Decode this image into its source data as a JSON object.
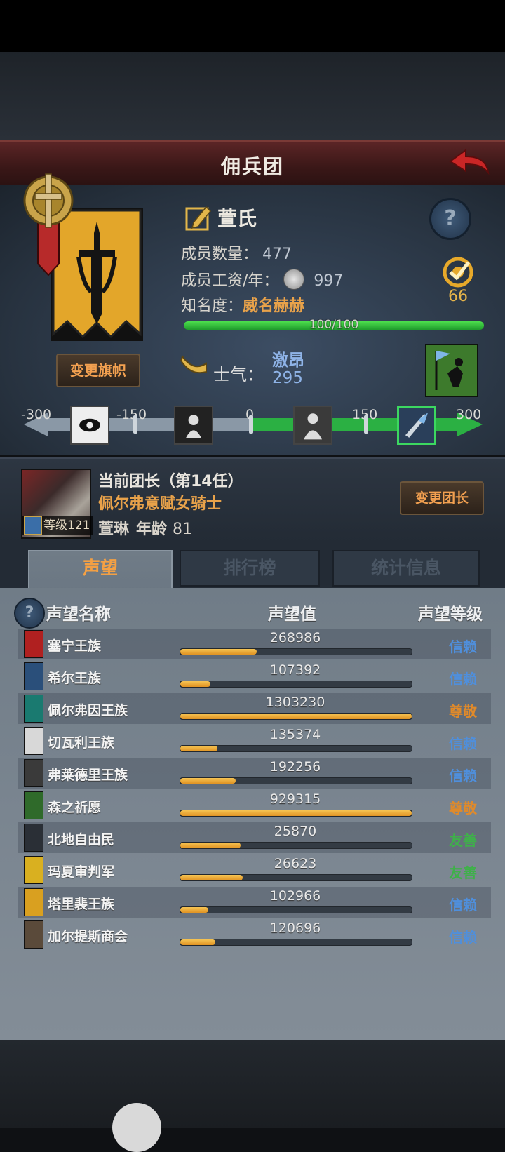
{
  "title": "佣兵团",
  "company": {
    "name": "萱氏",
    "change_flag": "变更旗帜",
    "members_label": "成员数量：",
    "members_value": "477",
    "wage_label": "成员工资/年：",
    "wage_value": "997",
    "fame_label": "知名度：",
    "fame_value": "威名赫赫",
    "fame_progress": "100/100",
    "fame_fraction": 1.0,
    "target_value": "66",
    "morale_label": "士气：",
    "morale_state": "激昂",
    "morale_value": "295"
  },
  "morale_scale": {
    "ticks": [
      "-300",
      "-150",
      "0",
      "150",
      "300"
    ],
    "current": 295,
    "range": [
      -300,
      300
    ]
  },
  "leader": {
    "title": "当前团长（第14任）",
    "class": "佩尔弗意赋女骑士",
    "name": "萱琳",
    "age_label": "年龄",
    "age_value": "81",
    "level": "等级121",
    "change_leader": "变更团长"
  },
  "tabs": [
    {
      "label": "声望",
      "active": true
    },
    {
      "label": "排行榜",
      "active": false
    },
    {
      "label": "统计信息",
      "active": false
    }
  ],
  "reputation": {
    "headers": {
      "name": "声望名称",
      "value": "声望值",
      "level": "声望等级"
    },
    "rows": [
      {
        "name": "塞宁王族",
        "value": "268986",
        "fill": 0.33,
        "level": "信赖",
        "level_color": "#4f8fdc",
        "crest_color": "#b02020"
      },
      {
        "name": "希尔王族",
        "value": "107392",
        "fill": 0.13,
        "level": "信赖",
        "level_color": "#4f8fdc",
        "crest_color": "#2a4f7a"
      },
      {
        "name": "佩尔弗因王族",
        "value": "1303230",
        "fill": 1.0,
        "level": "尊敬",
        "level_color": "#e08a2a",
        "crest_color": "#1a7a70"
      },
      {
        "name": "切瓦利王族",
        "value": "135374",
        "fill": 0.16,
        "level": "信赖",
        "level_color": "#4f8fdc",
        "crest_color": "#d8d8d8"
      },
      {
        "name": "弗莱德里王族",
        "value": "192256",
        "fill": 0.24,
        "level": "信赖",
        "level_color": "#4f8fdc",
        "crest_color": "#3a3a3a"
      },
      {
        "name": "森之祈愿",
        "value": "929315",
        "fill": 1.0,
        "level": "尊敬",
        "level_color": "#e08a2a",
        "crest_color": "#2f6a2a"
      },
      {
        "name": "北地自由民",
        "value": "25870",
        "fill": 0.26,
        "level": "友善",
        "level_color": "#3fb04a",
        "crest_color": "#2a2f36"
      },
      {
        "name": "玛夏审判军",
        "value": "26623",
        "fill": 0.27,
        "level": "友善",
        "level_color": "#3fb04a",
        "crest_color": "#d9b020"
      },
      {
        "name": "塔里裴王族",
        "value": "102966",
        "fill": 0.12,
        "level": "信赖",
        "level_color": "#4f8fdc",
        "crest_color": "#d9a020"
      },
      {
        "name": "加尔提斯商会",
        "value": "120696",
        "fill": 0.15,
        "level": "信赖",
        "level_color": "#4f8fdc",
        "crest_color": "#5a4a3a"
      }
    ]
  }
}
